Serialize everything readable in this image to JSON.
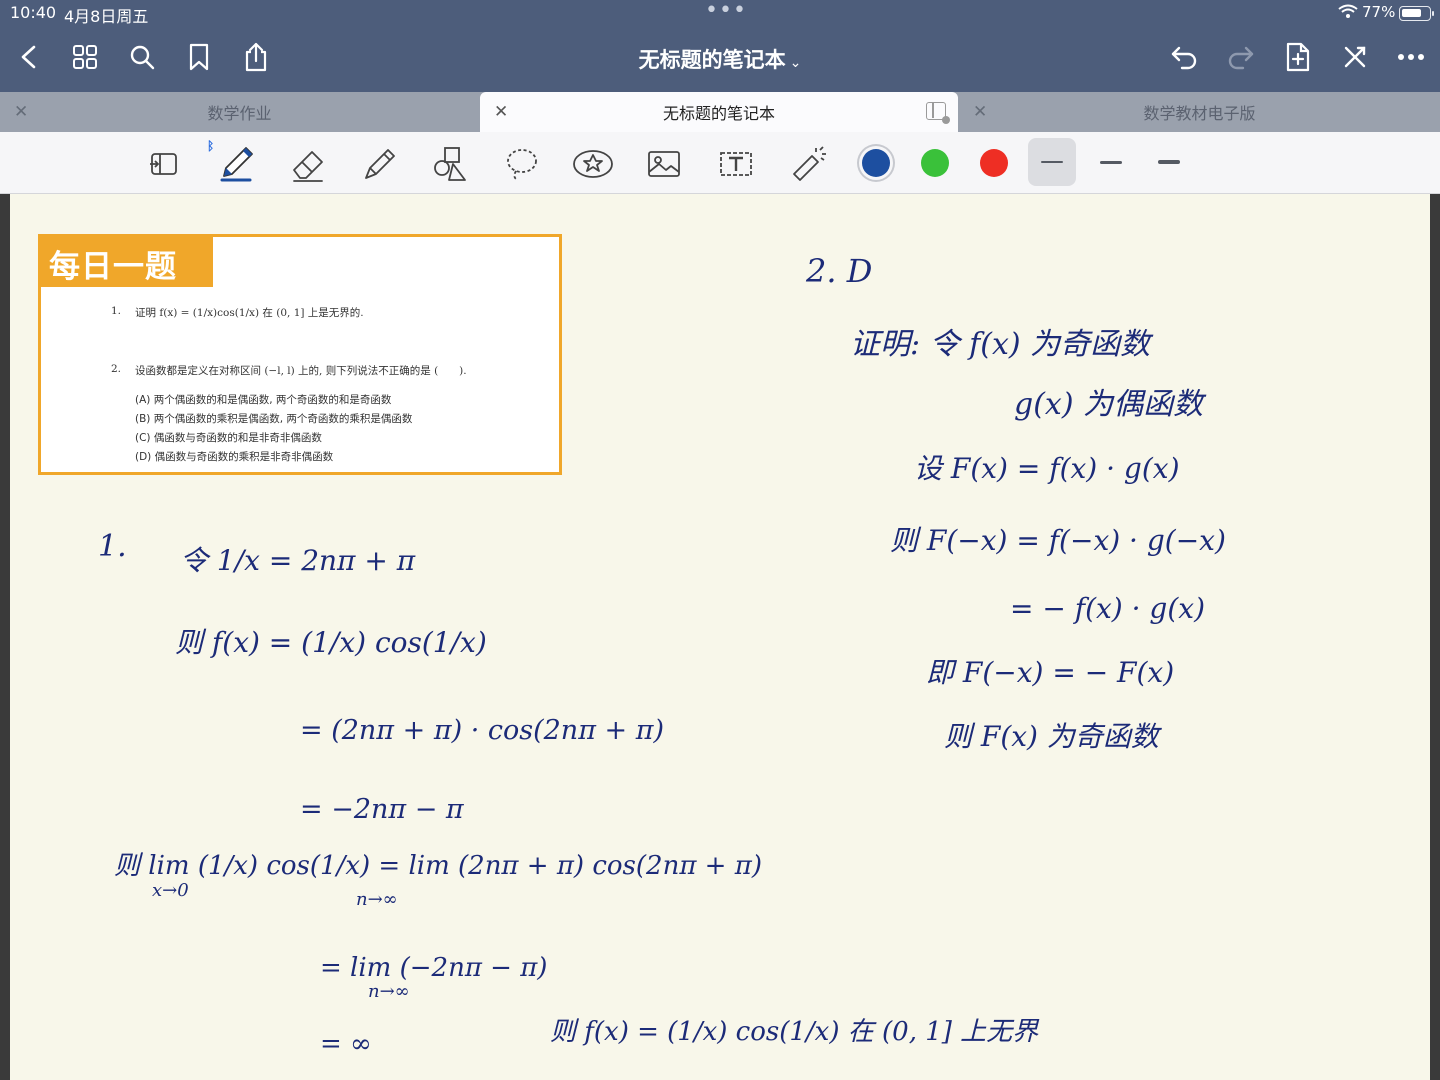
{
  "status_bar": {
    "time": "10:40",
    "date": "4月8日周五",
    "battery": "77%",
    "battery_level": 0.77
  },
  "nav": {
    "title": "无标题的笔记本",
    "title_chevron": "⌄"
  },
  "tabs": [
    {
      "label": "数学作业",
      "active": false
    },
    {
      "label": "无标题的笔记本",
      "active": true
    },
    {
      "label": "数学教材电子版",
      "active": false
    }
  ],
  "toolbar": {
    "colors": [
      "#1d4fa0",
      "#3ac13a",
      "#ee2e24"
    ],
    "selected_color": 0,
    "selected_width": 0
  },
  "card": {
    "banner": "每日一题",
    "q1_num": "1.",
    "q1_text": "证明  f(x) = (1/x)cos(1/x)  在 (0, 1] 上是无界的.",
    "q2_num": "2.",
    "q2_text": "设函数都是定义在对称区间 (−l, l) 上的, 则下列说法不正确的是 (　　).",
    "options": [
      "(A)  两个偶函数的和是偶函数, 两个奇函数的和是奇函数",
      "(B)  两个偶函数的乘积是偶函数, 两个奇函数的乘积是偶函数",
      "(C)  偶函数与奇函数的和是非奇非偶函数",
      "(D)  偶函数与奇函数的乘积是非奇非偶函数"
    ]
  },
  "handwriting": {
    "left": [
      "1.",
      "令 1/x = 2nπ + π",
      "则  f(x) = (1/x) cos(1/x)",
      "= (2nπ + π) · cos(2nπ + π)",
      "= −2nπ − π",
      "则  lim (1/x) cos(1/x)  =  lim (2nπ + π) cos(2nπ + π)",
      "x→0",
      "n→∞",
      "=  lim (−2nπ − π)",
      "n→∞",
      "= ∞",
      "则  f(x) = (1/x) cos(1/x)  在 (0, 1] 上无界"
    ],
    "right": [
      "2.   D",
      "证明:  令 f(x) 为奇函数",
      "g(x) 为偶函数",
      "设 F(x) = f(x) · g(x)",
      "则 F(−x) = f(−x) · g(−x)",
      "= − f(x) · g(x)",
      "即 F(−x) = − F(x)",
      "则 F(x) 为奇函数"
    ]
  }
}
